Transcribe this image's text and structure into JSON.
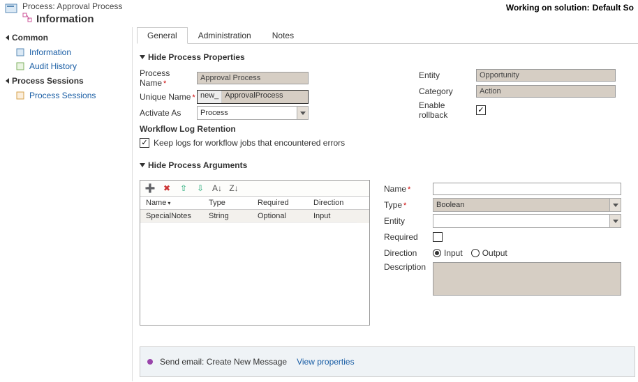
{
  "header": {
    "process_line": "Process: Approval Process",
    "main_title": "Information",
    "solution_label": "Working on solution:",
    "solution_name": "Default So"
  },
  "sidebar": {
    "section1": {
      "title": "Common",
      "items": [
        {
          "label": "Information"
        },
        {
          "label": "Audit History"
        }
      ]
    },
    "section2": {
      "title": "Process Sessions",
      "items": [
        {
          "label": "Process Sessions"
        }
      ]
    }
  },
  "tabs": [
    {
      "label": "General",
      "active": true
    },
    {
      "label": "Administration",
      "active": false
    },
    {
      "label": "Notes",
      "active": false
    }
  ],
  "properties": {
    "section_title": "Hide Process Properties",
    "process_name_label": "Process Name",
    "process_name_value": "Approval Process",
    "unique_name_label": "Unique Name",
    "unique_name_prefix": "new_",
    "unique_name_value": "ApprovalProcess",
    "activate_as_label": "Activate As",
    "activate_as_value": "Process",
    "entity_label": "Entity",
    "entity_value": "Opportunity",
    "category_label": "Category",
    "category_value": "Action",
    "enable_rollback_label": "Enable rollback",
    "retention_header": "Workflow Log Retention",
    "retention_check_label": "Keep logs for workflow jobs that encountered errors"
  },
  "arguments": {
    "section_title": "Hide Process Arguments",
    "grid_headers": {
      "name": "Name",
      "type": "Type",
      "required": "Required",
      "direction": "Direction"
    },
    "rows": [
      {
        "name": "SpecialNotes",
        "type": "String",
        "required": "Optional",
        "direction": "Input"
      }
    ],
    "detail": {
      "name_label": "Name",
      "name_value": "",
      "type_label": "Type",
      "type_value": "Boolean",
      "entity_label": "Entity",
      "entity_value": "",
      "required_label": "Required",
      "direction_label": "Direction",
      "direction_options": {
        "input": "Input",
        "output": "Output"
      },
      "description_label": "Description"
    }
  },
  "footer_step": {
    "text": "Send email:  Create New Message",
    "link": "View properties"
  }
}
